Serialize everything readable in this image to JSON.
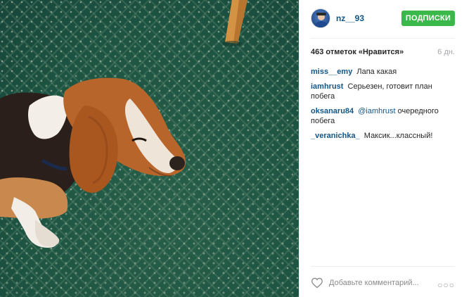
{
  "post": {
    "username": "nz__93",
    "follow_label": "ПОДПИСКИ",
    "likes_text": "463 отметок «Нравится»",
    "time_ago": "6 дн.",
    "comments": [
      {
        "user": "miss__emy",
        "mention": "",
        "text": "Лапа какая"
      },
      {
        "user": "iamhrust",
        "mention": "",
        "text": "Серьезен, готовит план побега"
      },
      {
        "user": "oksanaru84",
        "mention": "@iamhrust",
        "text": "очередного побега"
      },
      {
        "user": "_veranichka_",
        "mention": "",
        "text": "Максик...классный!"
      }
    ],
    "comment_placeholder": "Добавьте комментарий...",
    "more_glyph": "○○○"
  },
  "colors": {
    "link": "#125688",
    "follow_button": "#3bb84a",
    "carpet": "#1f5a45"
  },
  "icons": [
    "heart-icon",
    "more-options-icon"
  ],
  "photo": {
    "subject": "beagle on green patterned carpet"
  }
}
